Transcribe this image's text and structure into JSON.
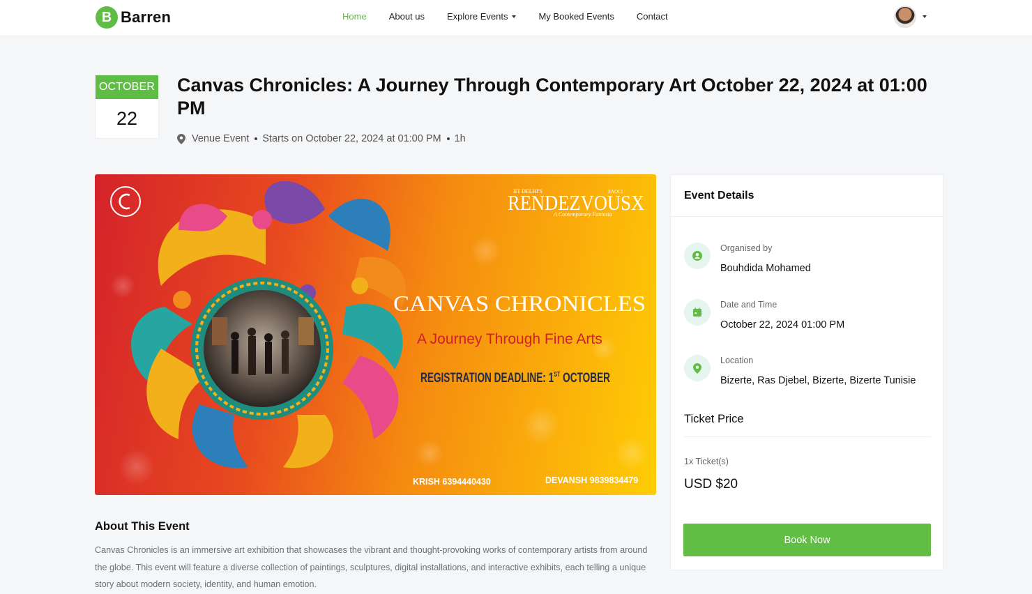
{
  "brand": {
    "mark": "B",
    "name": "Barren",
    "color": "#5fbd45"
  },
  "nav": {
    "items": [
      {
        "label": "Home",
        "active": true
      },
      {
        "label": "About us"
      },
      {
        "label": "Explore Events",
        "dropdown": true
      },
      {
        "label": "My Booked Events"
      },
      {
        "label": "Contact"
      }
    ]
  },
  "event": {
    "month": "OCTOBER",
    "day": "22",
    "title": "Canvas Chronicles: A Journey Through Contemporary Art October 22, 2024 at 01:00 PM",
    "venue_type": "Venue Event",
    "starts": "Starts on October 22, 2024 at 01:00 PM",
    "duration": "1h"
  },
  "banner": {
    "brand_small": "IIT DELHI'S",
    "brand_right": "SAOCI",
    "brand_big": "RENDEZVOUSX",
    "brand_sub": "A Contemporary Fantasia",
    "headline": "CANVAS CHRONICLES",
    "tagline": "A Journey Through Fine Arts",
    "deadline_prefix": "REGISTRATION DEADLINE: 1",
    "deadline_sup": "ST",
    "deadline_suffix": " OCTOBER",
    "contact_1": "KRISH 6394440430",
    "contact_2": "DEVANSH 9839834479"
  },
  "about": {
    "title": "About This Event",
    "text": "Canvas Chronicles is an immersive art exhibition that showcases the vibrant and thought-provoking works of contemporary artists from around the globe. This event will feature a diverse collection of paintings, sculptures, digital installations, and interactive exhibits, each telling a unique story about modern society, identity, and human emotion."
  },
  "details": {
    "title": "Event Details",
    "organised_label": "Organised by",
    "organised_value": "Bouhdida Mohamed",
    "datetime_label": "Date and Time",
    "datetime_value": "October 22, 2024 01:00 PM",
    "location_label": "Location",
    "location_value": "Bizerte, Ras Djebel, Bizerte, Bizerte Tunisie",
    "ticket_title": "Ticket Price",
    "ticket_qty": "1x Ticket(s)",
    "ticket_price": "USD $20",
    "book_label": "Book Now",
    "accent": "#5fbd45",
    "icon_bg": "#e6f6ef"
  },
  "icons": [
    "user-icon",
    "calendar-icon",
    "map-pin-icon",
    "caret-down-icon"
  ]
}
